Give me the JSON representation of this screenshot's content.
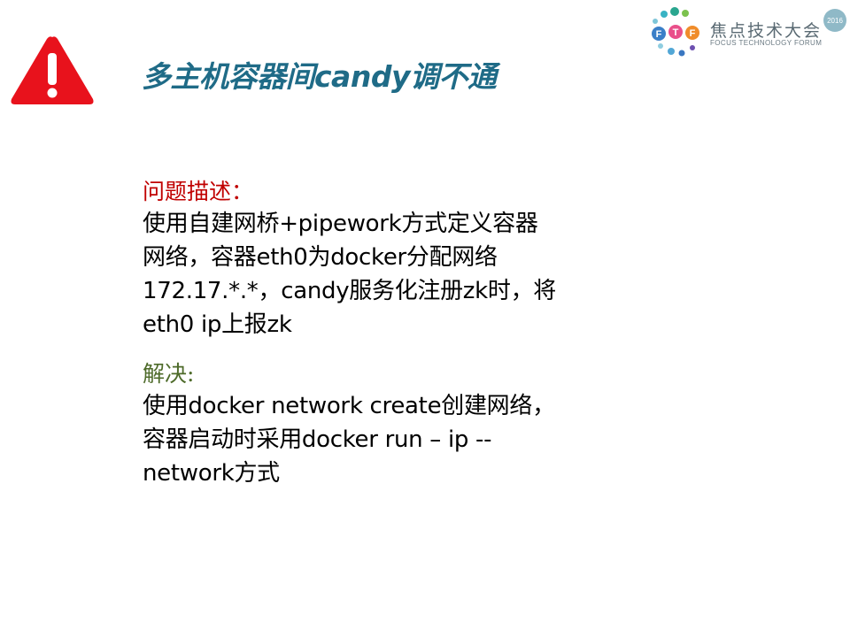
{
  "header": {
    "title": "多主机容器间candy调不通",
    "warning_icon": "warning-triangle-icon",
    "warning_color": "#e8121c"
  },
  "logo": {
    "mark": "FTF",
    "name_cn": "焦点技术大会",
    "name_en": "FOCUS TECHNOLOGY FORUM",
    "year": "2016"
  },
  "problem": {
    "heading": "问题描述：",
    "lines": [
      "使用自建网桥+pipework方式定义容器",
      "网络，容器eth0为docker分配网络",
      "172.17.*.*，candy服务化注册zk时，将",
      "eth0 ip上报zk"
    ]
  },
  "solution": {
    "heading": "解决:",
    "lines": [
      "使用docker network create创建网络，",
      "容器启动时采用docker run  – ip --",
      "network方式"
    ]
  },
  "colors": {
    "title": "#1f6b87",
    "problem_heading": "#c00000",
    "solution_heading": "#4e6b2a"
  }
}
